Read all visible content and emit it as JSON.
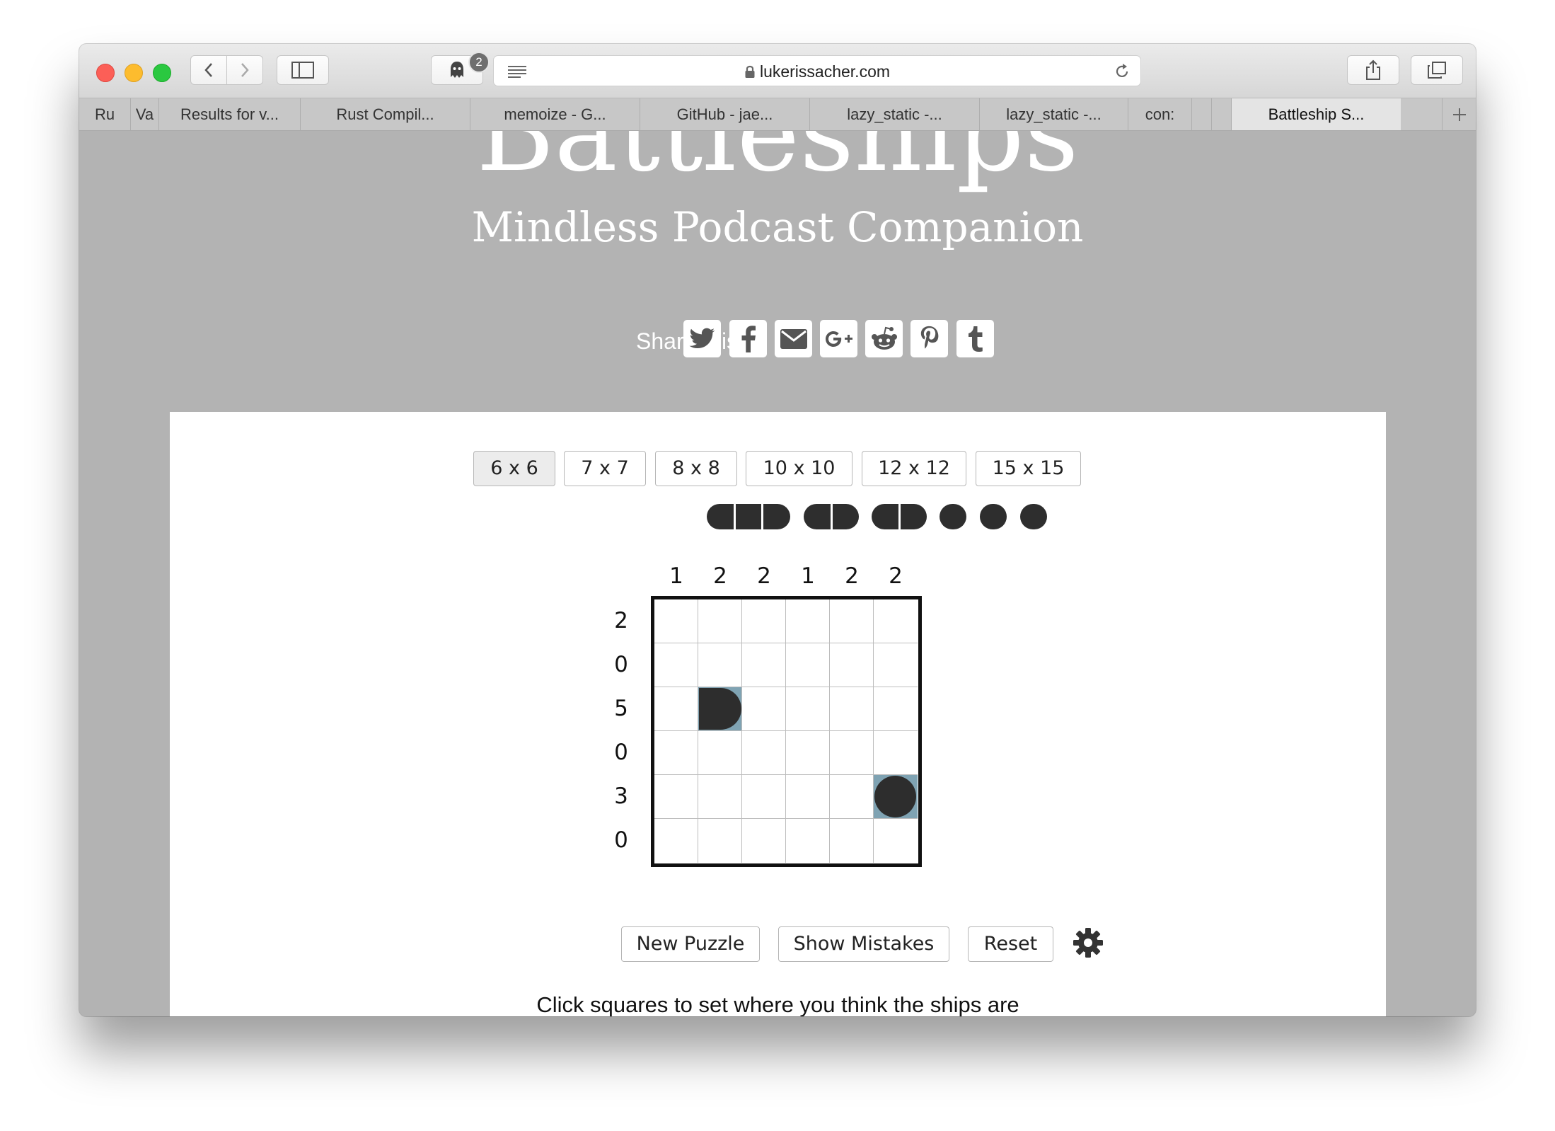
{
  "browser": {
    "address": "lukerissacher.com",
    "extension_badge": "2",
    "tabs": [
      {
        "label": "Ru"
      },
      {
        "label": "Va"
      },
      {
        "label": "Results for v..."
      },
      {
        "label": "Rust Compil..."
      },
      {
        "label": "memoize - G..."
      },
      {
        "label": "GitHub - jae..."
      },
      {
        "label": "lazy_static -..."
      },
      {
        "label": "lazy_static -..."
      },
      {
        "label": "con:"
      },
      {
        "label": ""
      },
      {
        "label": "Battleship S..."
      }
    ],
    "active_tab_index": 10
  },
  "page": {
    "title": "Battleships",
    "subtitle": "Mindless Podcast Companion",
    "share_label": "Share this:",
    "share_icons": [
      "twitter-icon",
      "facebook-icon",
      "email-icon",
      "google-plus-icon",
      "reddit-icon",
      "pinterest-icon",
      "tumblr-icon"
    ]
  },
  "puzzle": {
    "sizes": [
      "6 x 6",
      "7 x 7",
      "8 x 8",
      "10 x 10",
      "12 x 12",
      "15 x 15"
    ],
    "selected_size": "6 x 6",
    "fleet_lengths": [
      3,
      2,
      2,
      1,
      1,
      1
    ],
    "column_counts": [
      "1",
      "2",
      "2",
      "1",
      "2",
      "2"
    ],
    "row_counts": [
      "2",
      "0",
      "5",
      "0",
      "3",
      "0"
    ],
    "revealed": [
      {
        "row": 3,
        "col": 2,
        "shape": "ship end (right)"
      },
      {
        "row": 5,
        "col": 6,
        "shape": "single ship"
      }
    ],
    "buttons": {
      "new_puzzle": "New Puzzle",
      "show_mistakes": "Show Mistakes",
      "reset": "Reset"
    },
    "instructions": "Click squares to set where you think the ships are"
  },
  "colors": {
    "page_bg": "#b3b3b3",
    "ship": "#2d2d2d",
    "revealed_cell": "#7fa3b3"
  }
}
